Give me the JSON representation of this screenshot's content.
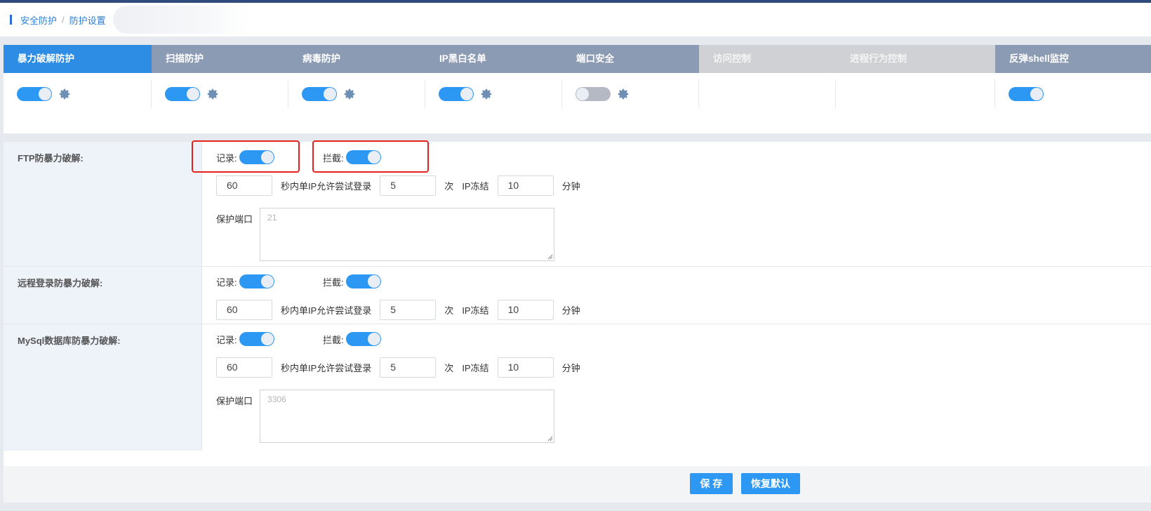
{
  "breadcrumb": {
    "items": [
      "安全防护",
      "防护设置"
    ],
    "separator": "/"
  },
  "tabs": [
    {
      "label": "暴力破解防护",
      "state": "active",
      "switch": "on",
      "gear": true
    },
    {
      "label": "扫描防护",
      "state": "normal",
      "switch": "on",
      "gear": true
    },
    {
      "label": "病毒防护",
      "state": "normal",
      "switch": "on",
      "gear": true
    },
    {
      "label": "IP黑白名单",
      "state": "normal",
      "switch": "on",
      "gear": true
    },
    {
      "label": "端口安全",
      "state": "normal",
      "switch": "off",
      "gear": true
    },
    {
      "label": "访问控制",
      "state": "disabled",
      "switch": null,
      "gear": false
    },
    {
      "label": "进程行为控制",
      "state": "disabled",
      "switch": null,
      "gear": false
    },
    {
      "label": "反弹shell监控",
      "state": "normal",
      "switch": "on",
      "gear": false
    }
  ],
  "sections": [
    {
      "title": "FTP防暴力破解:",
      "record_label": "记录:",
      "record_on": true,
      "block_label": "拦截:",
      "block_on": true,
      "seconds": "60",
      "attempts_text": "秒内单IP允许尝试登录",
      "attempts": "5",
      "times_unit": "次",
      "freeze_text": "IP冻结",
      "freeze": "10",
      "freeze_unit": "分钟",
      "port_label": "保护端口",
      "port_placeholder": "21"
    },
    {
      "title": "远程登录防暴力破解:",
      "record_label": "记录:",
      "record_on": true,
      "block_label": "拦截:",
      "block_on": true,
      "seconds": "60",
      "attempts_text": "秒内单IP允许尝试登录",
      "attempts": "5",
      "times_unit": "次",
      "freeze_text": "IP冻结",
      "freeze": "10",
      "freeze_unit": "分钟"
    },
    {
      "title": "MySql数据库防暴力破解:",
      "record_label": "记录:",
      "record_on": true,
      "block_label": "拦截:",
      "block_on": true,
      "seconds": "60",
      "attempts_text": "秒内单IP允许尝试登录",
      "attempts": "5",
      "times_unit": "次",
      "freeze_text": "IP冻结",
      "freeze": "10",
      "freeze_unit": "分钟",
      "port_label": "保护端口",
      "port_placeholder": "3306"
    }
  ],
  "buttons": {
    "save": "保 存",
    "reset": "恢复默认"
  },
  "colors": {
    "accent": "#2d98f3",
    "active_tab": "#2d8ce3",
    "tab": "#8c9bb4",
    "disabled_tab": "#cfd1d4",
    "highlight": "#e5221d"
  }
}
